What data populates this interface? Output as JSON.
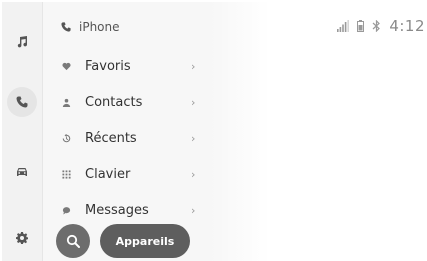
{
  "header": {
    "source": "iPhone",
    "source_icon": "phone-icon"
  },
  "rail": {
    "items": [
      {
        "name": "music",
        "icon": "music-note-icon",
        "active": false
      },
      {
        "name": "phone",
        "icon": "phone-icon",
        "active": true
      },
      {
        "name": "vehicle",
        "icon": "car-icon",
        "active": false
      },
      {
        "name": "settings",
        "icon": "gear-icon",
        "active": false
      }
    ]
  },
  "menu": {
    "items": [
      {
        "label": "Favoris",
        "icon": "heart-icon"
      },
      {
        "label": "Contacts",
        "icon": "person-icon"
      },
      {
        "label": "Récents",
        "icon": "history-icon"
      },
      {
        "label": "Clavier",
        "icon": "keypad-icon"
      },
      {
        "label": "Messages",
        "icon": "message-icon"
      }
    ],
    "chevron": "›"
  },
  "bottom": {
    "devices_label": "Appareils",
    "search_icon": "search-icon"
  },
  "status": {
    "time": "4:12",
    "icons": [
      "signal-icon",
      "battery-icon",
      "bluetooth-icon"
    ]
  },
  "colors": {
    "rail_bg": "#f2f2f2",
    "panel_bg": "#f7f7f7",
    "pill_bg": "#5e5e5e",
    "search_bg": "#6d6d6d"
  }
}
